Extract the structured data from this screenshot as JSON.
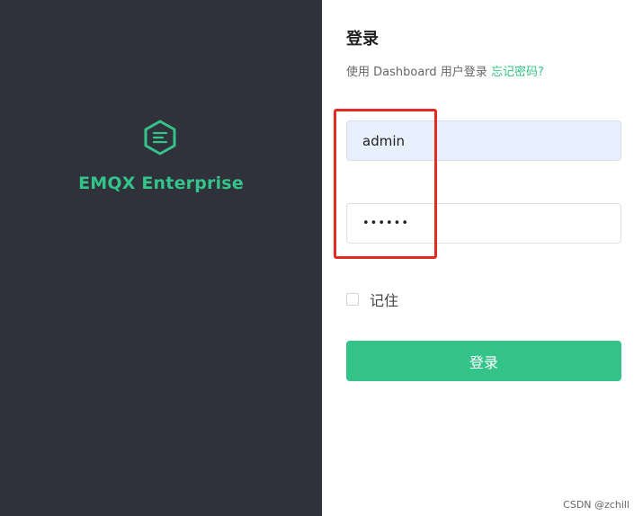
{
  "brand": {
    "name": "EMQX Enterprise",
    "logo_icon": "emqx-hexagon-logo-icon",
    "color": "#34c388"
  },
  "form": {
    "title": "登录",
    "subtitle_prefix": "使用 Dashboard 用户登录",
    "forgot_link": "忘记密码?",
    "username_value": "admin",
    "password_value": "••••••",
    "remember_label": "记住",
    "submit_label": "登录"
  },
  "colors": {
    "sidebar_bg": "#2f323b",
    "accent": "#34c388",
    "highlight_box": "#e32b22",
    "autofill_bg": "#e8f0fe"
  },
  "watermark": "CSDN @zchill"
}
